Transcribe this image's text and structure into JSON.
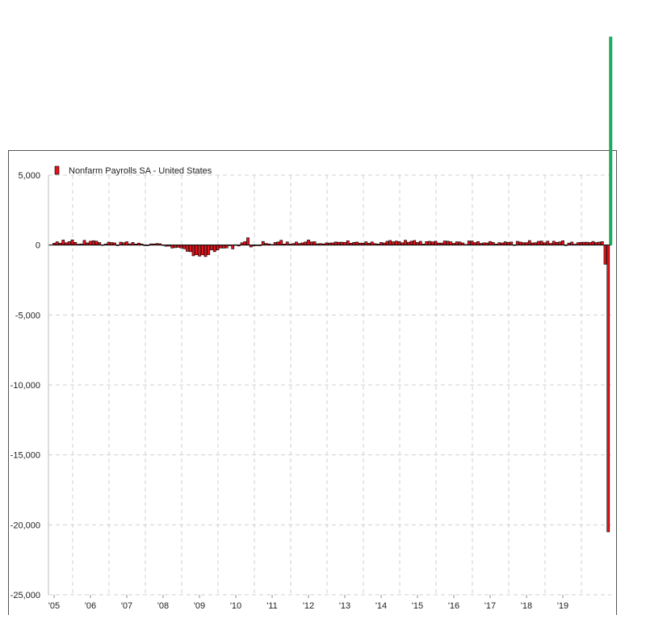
{
  "chart_data": {
    "type": "bar",
    "title": "",
    "xlabel": "",
    "ylabel": "",
    "ylim": [
      -25000,
      5000
    ],
    "yticks": [
      5000,
      0,
      -5000,
      -10000,
      -15000,
      -20000,
      -25000
    ],
    "ytick_labels": [
      "5,000",
      "0",
      "-5,000",
      "-10,000",
      "-15,000",
      "-20,000",
      "-25,000"
    ],
    "xtick_labels": [
      "'05",
      "'06",
      "'07",
      "'08",
      "'09",
      "'10",
      "'11",
      "'12",
      "'13",
      "'14",
      "'15",
      "'16",
      "'17",
      "'18",
      "'19"
    ],
    "grid": true,
    "legend_position": "top-left",
    "colors": {
      "bar": "#e8121b",
      "bar_edge": "#000000",
      "annotation": "#1fab5a",
      "grid": "#d0d0d0",
      "frame": "#555555"
    },
    "series": [
      {
        "name": "Nonfarm Payrolls SA - United States",
        "start": "2005-01",
        "frequency": "monthly",
        "values": [
          134,
          239,
          142,
          360,
          169,
          246,
          373,
          196,
          67,
          84,
          337,
          160,
          277,
          315,
          280,
          182,
          23,
          77,
          207,
          184,
          157,
          2,
          210,
          171,
          240,
          90,
          189,
          79,
          143,
          78,
          -33,
          -24,
          88,
          84,
          114,
          97,
          17,
          -84,
          -78,
          -210,
          -186,
          -162,
          -213,
          -267,
          -450,
          -474,
          -766,
          -694,
          -793,
          -702,
          -823,
          -687,
          -349,
          -472,
          -349,
          -213,
          -220,
          -204,
          -2,
          -275,
          23,
          -68,
          164,
          243,
          524,
          -137,
          -68,
          -36,
          -52,
          262,
          119,
          87,
          43,
          189,
          225,
          346,
          77,
          225,
          69,
          110,
          220,
          112,
          157,
          223,
          365,
          226,
          243,
          96,
          110,
          88,
          160,
          150,
          161,
          225,
          203,
          208,
          190,
          311,
          135,
          192,
          218,
          146,
          140,
          238,
          137,
          225,
          109,
          79,
          190,
          151,
          272,
          330,
          236,
          286,
          249,
          164,
          347,
          205,
          278,
          329,
          190,
          271,
          72,
          251,
          273,
          228,
          277,
          150,
          149,
          295,
          280,
          239,
          126,
          237,
          225,
          153,
          43,
          297,
          291,
          176,
          249,
          124,
          164,
          155,
          259,
          195,
          73,
          175,
          155,
          239,
          190,
          221,
          14,
          271,
          216,
          175,
          176,
          324,
          155,
          175,
          270,
          286,
          165,
          282,
          119,
          277,
          196,
          227,
          312,
          1,
          147,
          216,
          62,
          178,
          194,
          207,
          208,
          185,
          261,
          184,
          214,
          251,
          -1373,
          -20500
        ]
      }
    ],
    "annotations": [
      {
        "type": "vertical-line",
        "date": "2020-04",
        "from_value": 0,
        "to_value": 14900
      }
    ]
  }
}
